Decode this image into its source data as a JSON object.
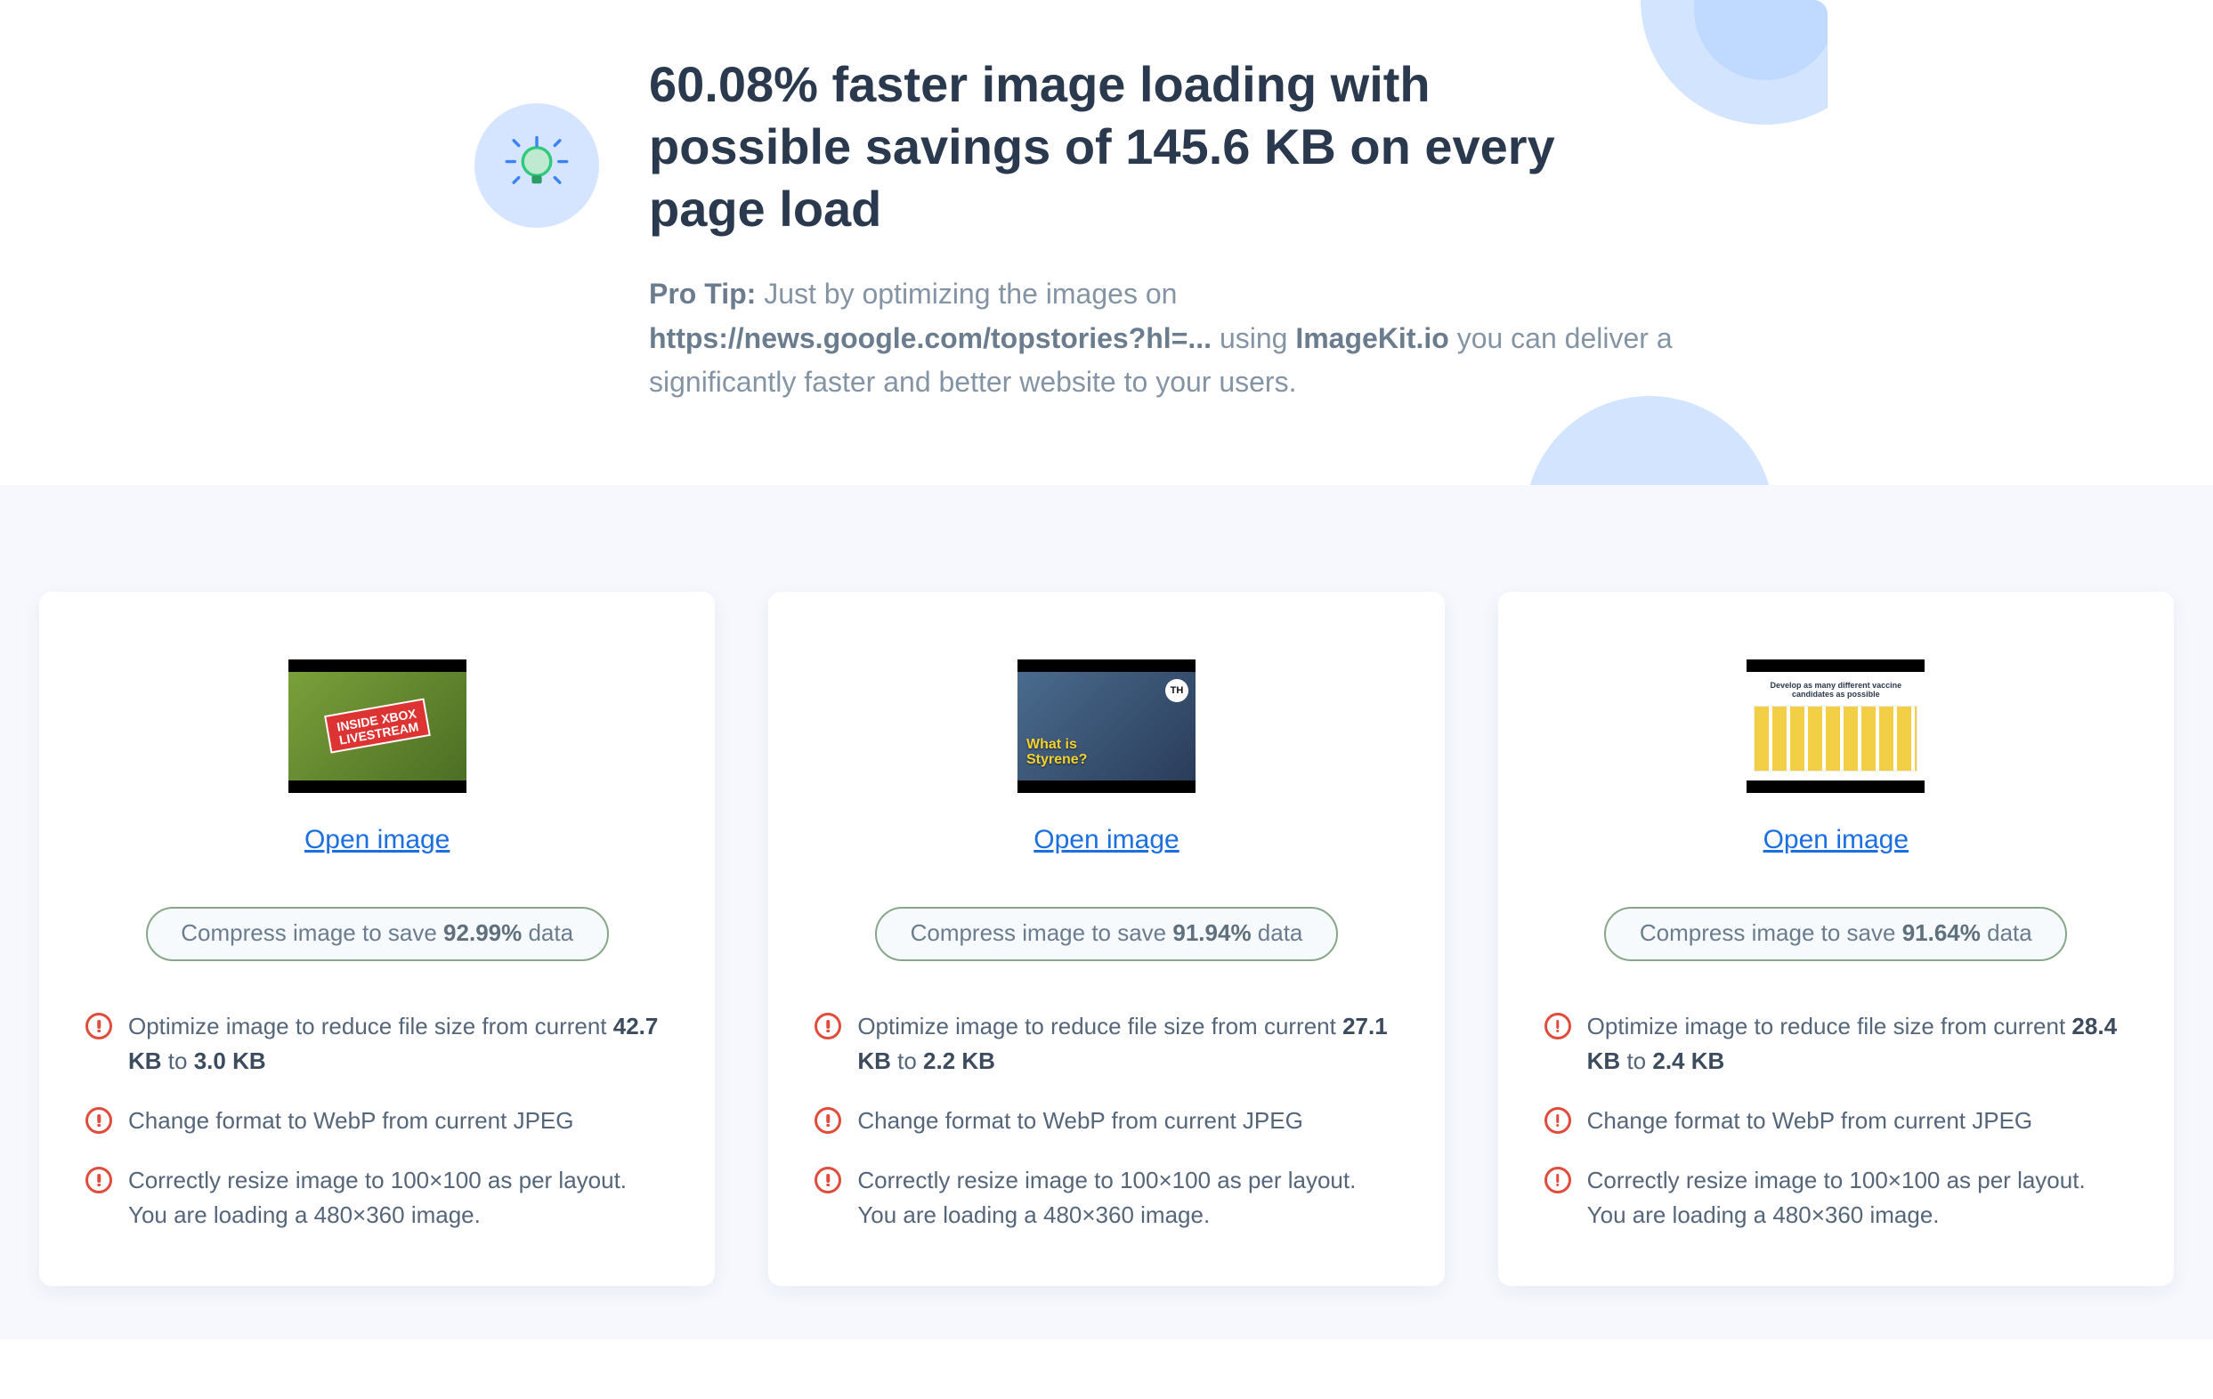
{
  "hero": {
    "headline_pct": "60.08%",
    "headline_mid": " faster image loading with possible savings of ",
    "headline_kb": "145.6 KB",
    "headline_end": " on every page load",
    "tip_lead": "Pro Tip:",
    "tip_a": " Just by optimizing the images on ",
    "tip_url": "https://news.google.com/topstories?hl=...",
    "tip_b": " using ",
    "tip_brand": "ImageKit.io",
    "tip_c": " you can deliver a significantly faster and better website to your users."
  },
  "cards": [
    {
      "open": "Open image",
      "pill_a": "Compress image to save ",
      "pill_pct": "92.99%",
      "pill_b": " data",
      "i1_a": "Optimize image to reduce file size from current ",
      "i1_from": "42.7 KB",
      "i1_mid": " to ",
      "i1_to": "3.0 KB",
      "i2": "Change format to WebP from current JPEG",
      "i3": "Correctly resize image to 100×100 as per layout. You are loading a 480×360 image.",
      "thumb_tag_1": "INSIDE XBOX",
      "thumb_tag_2": "LIVESTREAM"
    },
    {
      "open": "Open image",
      "pill_a": "Compress image to save ",
      "pill_pct": "91.94%",
      "pill_b": " data",
      "i1_a": "Optimize image to reduce file size from current ",
      "i1_from": "27.1 KB",
      "i1_mid": " to ",
      "i1_to": "2.2 KB",
      "i2": "Change format to WebP from current JPEG",
      "i3": "Correctly resize image to 100×100 as per layout. You are loading a 480×360 image.",
      "thumb_pill_1": "What is",
      "thumb_pill_2": "Styrene?",
      "thumb_logo": "TH"
    },
    {
      "open": "Open image",
      "pill_a": "Compress image to save ",
      "pill_pct": "91.64%",
      "pill_b": " data",
      "i1_a": "Optimize image to reduce file size from current ",
      "i1_from": "28.4 KB",
      "i1_mid": " to ",
      "i1_to": "2.4 KB",
      "i2": "Change format to WebP from current JPEG",
      "i3": "Correctly resize image to 100×100 as per layout. You are loading a 480×360 image.",
      "thumb_title": "Develop as many different vaccine candidates as possible"
    }
  ]
}
